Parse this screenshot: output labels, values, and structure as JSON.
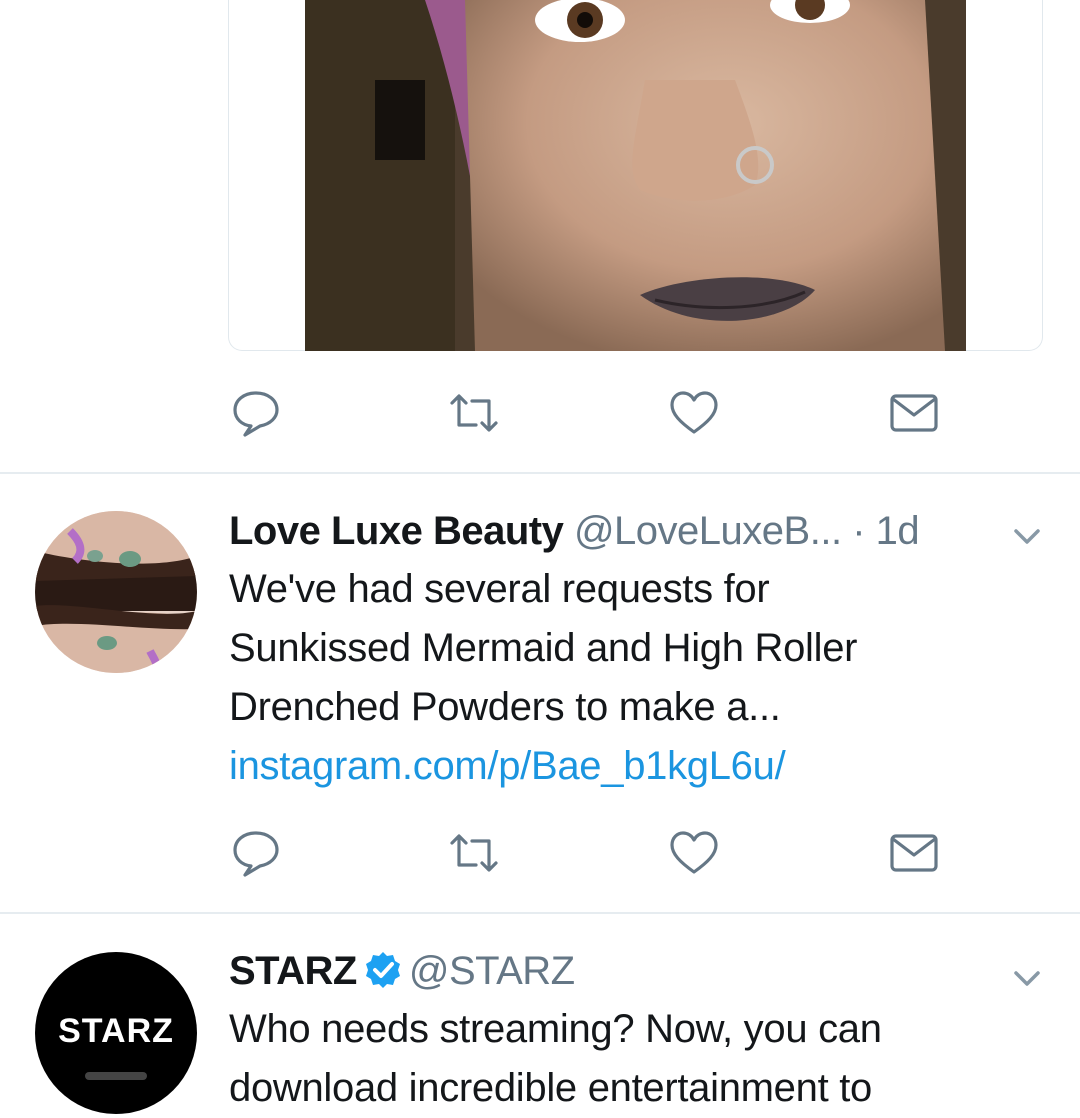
{
  "colors": {
    "icon_gray": "#657786",
    "link_blue": "#1b95e0",
    "verified_blue": "#1da1f2",
    "divider": "#e6ecf0",
    "text": "#14171a"
  },
  "tweets": [
    {
      "actions": [
        "reply-icon",
        "retweet-icon",
        "like-icon",
        "direct-message-icon"
      ]
    },
    {
      "name": "Love Luxe Beauty",
      "handle": "@LoveLuxeB...",
      "time": "· 1d",
      "text_lines": [
        "We've had several requests for",
        "Sunkissed Mermaid and High Roller",
        "Drenched Powders to make a..."
      ],
      "link": "instagram.com/p/Bae_b1kgL6u/",
      "actions": [
        "reply-icon",
        "retweet-icon",
        "like-icon",
        "direct-message-icon"
      ]
    },
    {
      "name": "STARZ",
      "handle": "@STARZ",
      "verified": true,
      "avatar_text": "STARZ",
      "text_lines": [
        "Who needs streaming? Now, you can",
        "download incredible entertainment to"
      ]
    }
  ]
}
